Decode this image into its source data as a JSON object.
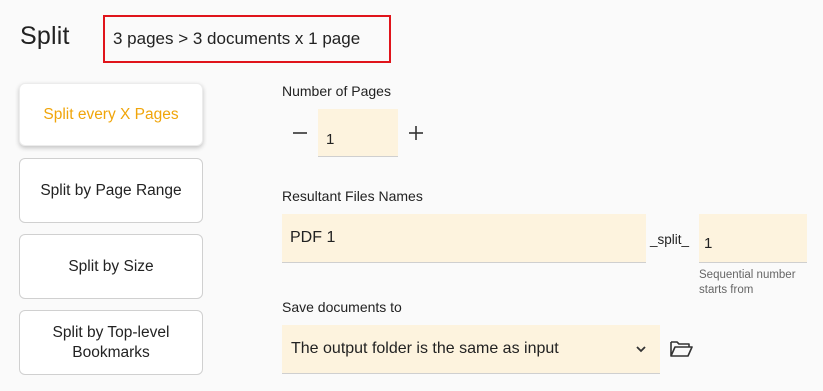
{
  "header": {
    "title": "Split",
    "summary": "3 pages > 3 documents x 1 page"
  },
  "modes": [
    {
      "label": "Split every X Pages",
      "active": true
    },
    {
      "label": "Split by Page Range",
      "active": false
    },
    {
      "label": "Split by Size",
      "active": false
    },
    {
      "label": "Split by Top-level Bookmarks",
      "active": false
    }
  ],
  "pages": {
    "label": "Number of Pages",
    "value": "1"
  },
  "names": {
    "label": "Resultant Files Names",
    "prefix_value": "PDF 1",
    "separator": "_split_",
    "sequence_value": "1",
    "helper": "Sequential number starts from"
  },
  "save": {
    "label": "Save documents to",
    "selected": "The output folder is the same as input"
  },
  "icons": {
    "minus": "minus-icon",
    "plus": "plus-icon",
    "chevron": "chevron-down-icon",
    "folder": "folder-open-icon"
  },
  "colors": {
    "accent": "#f0a50a",
    "field_bg": "#fdf3de",
    "highlight_border": "#e0141b"
  }
}
